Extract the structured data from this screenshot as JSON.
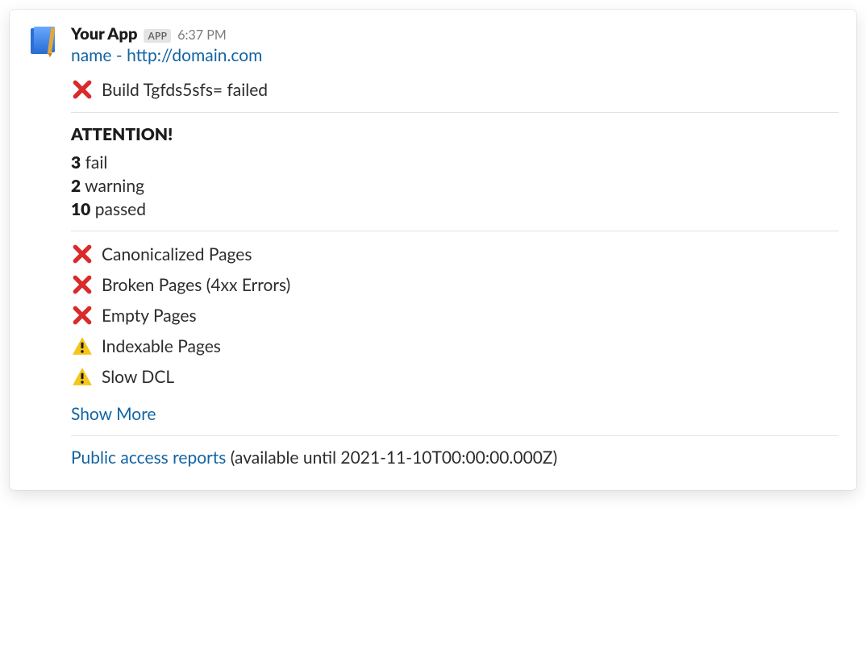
{
  "header": {
    "bot_name": "Your App",
    "badge": "APP",
    "timestamp": "6:37 PM",
    "title_link": "name - http://domain.com",
    "avatar_name": "app-avatar"
  },
  "build_status": {
    "icon": "cross",
    "text": "Build Tgfds5sfs= failed"
  },
  "attention": {
    "heading": "ATTENTION!",
    "stats": [
      {
        "count": "3",
        "label": "fail"
      },
      {
        "count": "2",
        "label": "warning"
      },
      {
        "count": "10",
        "label": "passed"
      }
    ]
  },
  "issues": [
    {
      "icon": "cross",
      "label": "Canonicalized Pages"
    },
    {
      "icon": "cross",
      "label": "Broken Pages (4xx Errors)"
    },
    {
      "icon": "cross",
      "label": "Empty Pages"
    },
    {
      "icon": "warn",
      "label": "Indexable Pages"
    },
    {
      "icon": "warn",
      "label": "Slow DCL"
    }
  ],
  "show_more": "Show More",
  "footer": {
    "link_text": "Public access reports",
    "suffix": " (available until 2021-11-10T00:00:00.000Z)"
  }
}
